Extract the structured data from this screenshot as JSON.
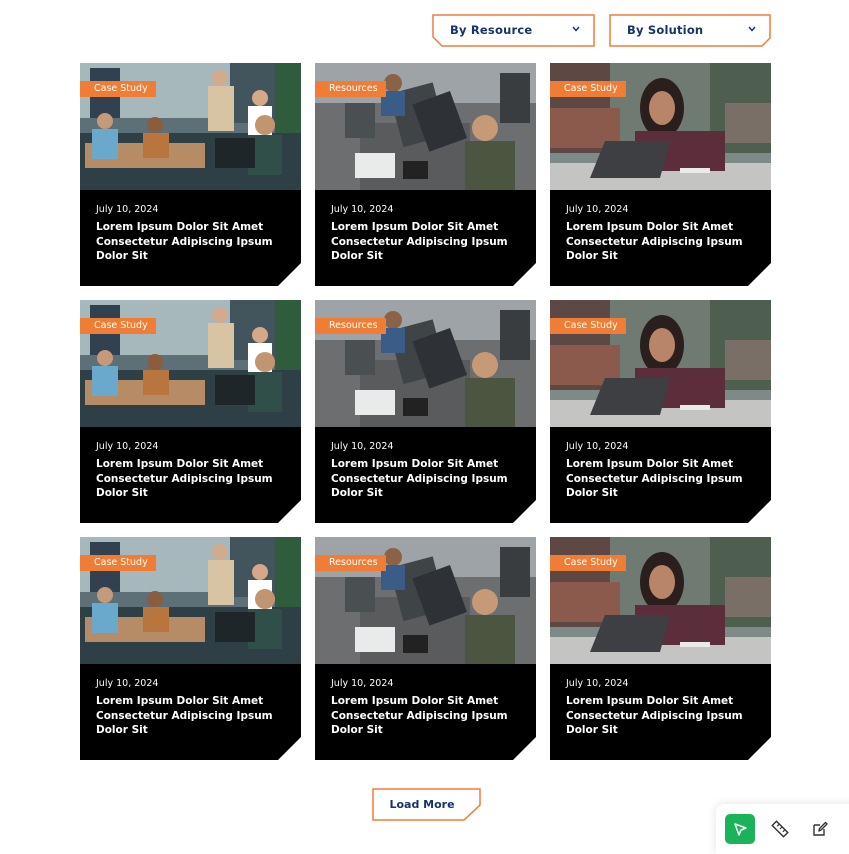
{
  "filters": {
    "resource_label": "By Resource",
    "solution_label": "By Solution"
  },
  "cards": [
    {
      "tag": "Case Study",
      "date": "July 10, 2024",
      "title": "Lorem Ipsum Dolor Sit Amet Consectetur Adipiscing Ipsum Dolor Sit",
      "image": "meeting-photo"
    },
    {
      "tag": "Resources",
      "date": "July 10, 2024",
      "title": "Lorem Ipsum Dolor Sit Amet Consectetur Adipiscing Ipsum Dolor Sit",
      "image": "office-desk-photo"
    },
    {
      "tag": "Case Study",
      "date": "July 10, 2024",
      "title": "Lorem Ipsum Dolor Sit Amet Consectetur Adipiscing Ipsum Dolor Sit",
      "image": "woman-laptop-photo"
    },
    {
      "tag": "Case Study",
      "date": "July 10, 2024",
      "title": "Lorem Ipsum Dolor Sit Amet Consectetur Adipiscing Ipsum Dolor Sit",
      "image": "meeting-photo"
    },
    {
      "tag": "Resources",
      "date": "July 10, 2024",
      "title": "Lorem Ipsum Dolor Sit Amet Consectetur Adipiscing Ipsum Dolor Sit",
      "image": "office-desk-photo"
    },
    {
      "tag": "Case Study",
      "date": "July 10, 2024",
      "title": "Lorem Ipsum Dolor Sit Amet Consectetur Adipiscing Ipsum Dolor Sit",
      "image": "woman-laptop-photo"
    },
    {
      "tag": "Case Study",
      "date": "July 10, 2024",
      "title": "Lorem Ipsum Dolor Sit Amet Consectetur Adipiscing Ipsum Dolor Sit",
      "image": "meeting-photo"
    },
    {
      "tag": "Resources",
      "date": "July 10, 2024",
      "title": "Lorem Ipsum Dolor Sit Amet Consectetur Adipiscing Ipsum Dolor Sit",
      "image": "office-desk-photo"
    },
    {
      "tag": "Case Study",
      "date": "July 10, 2024",
      "title": "Lorem Ipsum Dolor Sit Amet Consectetur Adipiscing Ipsum Dolor Sit",
      "image": "woman-laptop-photo"
    }
  ],
  "load_more": {
    "label": "Load More"
  },
  "toolbar": {
    "tools": [
      {
        "icon": "cursor-arrow-icon",
        "active": true
      },
      {
        "icon": "ruler-icon",
        "active": false
      },
      {
        "icon": "edit-icon",
        "active": false
      }
    ]
  },
  "colors": {
    "accent": "#f07d36",
    "navy": "#16336b",
    "card_bg": "#000000",
    "tool_active": "#1bb35a"
  }
}
